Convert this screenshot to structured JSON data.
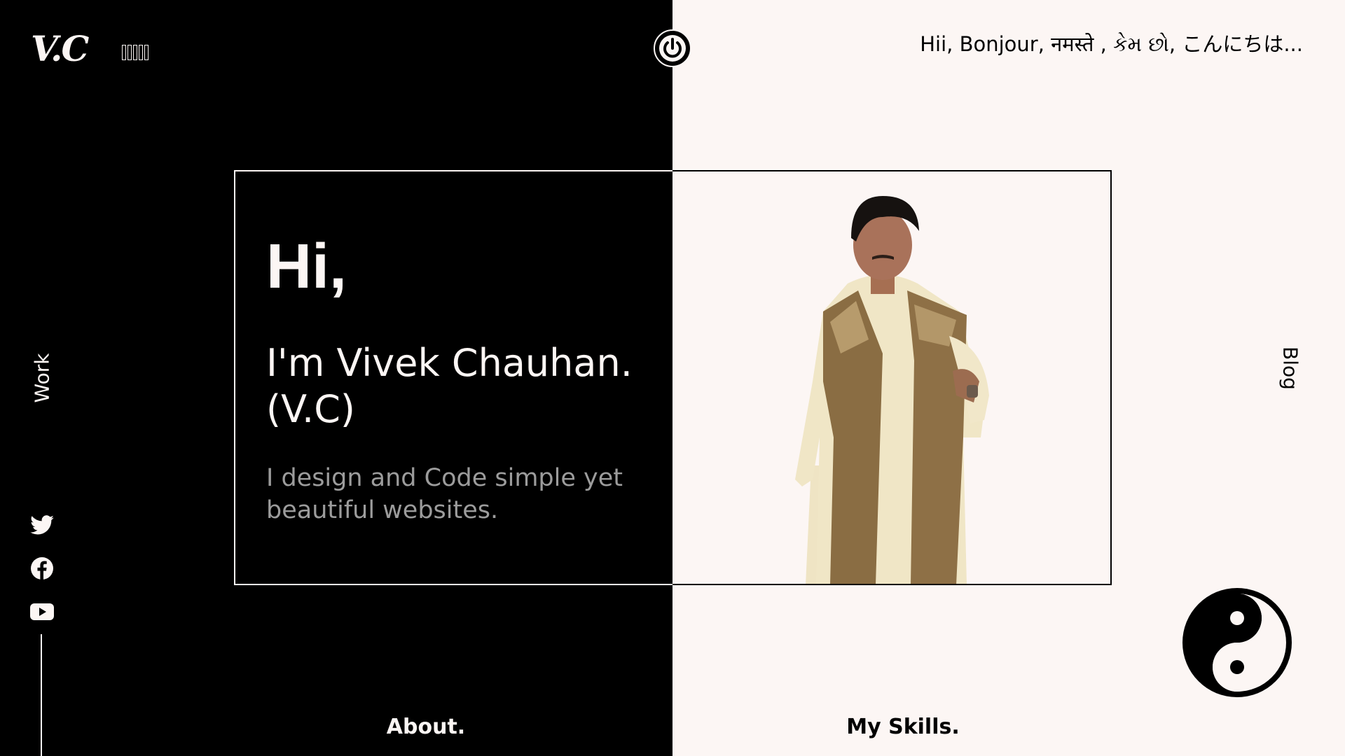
{
  "header": {
    "logo": "V.C",
    "menu_glyphs": [
      "",
      "",
      "",
      "",
      ""
    ],
    "theme_toggle_icon": "power-icon",
    "greeting": "Hii, Bonjour, नमस्ते , કેમ છો, こんにちは..."
  },
  "nav": {
    "work": "Work",
    "blog": "Blog",
    "about": "About.",
    "skills": "My Skills."
  },
  "social": [
    "twitter-icon",
    "facebook-icon",
    "youtube-icon"
  ],
  "intro": {
    "hi": "Hi,",
    "name": "I'm Vivek Chauhan. (V.C)",
    "tagline": "I design and Code simple yet beautiful websites."
  },
  "decor": {
    "yinyang_icon": "yin-yang-icon"
  },
  "colors": {
    "dark": "#000000",
    "light": "#fcf6f4",
    "muted_text": "#9c9c9c"
  }
}
